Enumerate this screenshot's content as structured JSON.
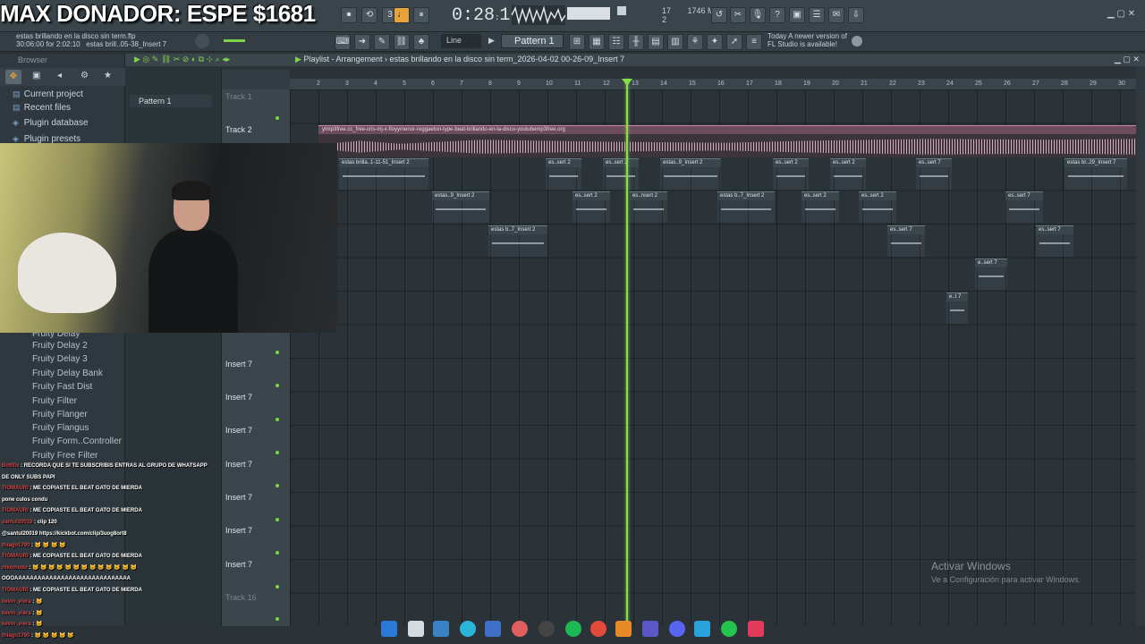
{
  "overlay": {
    "title": "MAX DONADOR: ESPE $1681"
  },
  "toolbar": {
    "time": "0:28",
    "time_sub": "16",
    "mem_top": "17",
    "mem_mb": "1746 MB",
    "mem_bottom": "2",
    "line_mode": "Line",
    "pattern": "Pattern 1"
  },
  "project": {
    "file": "estas brillando en la disco sin term.flp",
    "hint_time": "30:06:00 for 2:02:10",
    "hint_insert": "estas brill..05-38_Insert 7"
  },
  "news": {
    "line1": "Today  A newer version of",
    "line2": "FL Studio is available!"
  },
  "browser": {
    "title": "Browser",
    "items": [
      "Current project",
      "Recent files",
      "Plugin database",
      "Plugin presets"
    ],
    "plugins": [
      "Fruity Delay",
      "Fruity Delay 2",
      "Fruity Delay 3",
      "Fruity Delay Bank",
      "Fruity Fast Dist",
      "Fruity Filter",
      "Fruity Flanger",
      "Fruity Flangus",
      "Fruity Form..Controller",
      "Fruity Free Filter"
    ]
  },
  "patterns": {
    "item": "Pattern 1"
  },
  "playlist": {
    "title": "Playlist - Arrangement  ›  estas brillando en la disco sin term_2026-04-02 00-26-09_Insert 7",
    "ruler": [
      "2",
      "3",
      "4",
      "5",
      "6",
      "7",
      "8",
      "9",
      "10",
      "11",
      "12",
      "13",
      "14",
      "15",
      "16",
      "17",
      "18",
      "19",
      "20",
      "21",
      "22",
      "23",
      "24",
      "25",
      "26",
      "27",
      "28",
      "29",
      "30"
    ],
    "tracks": [
      "Track 1",
      "Track 2",
      "Insert 7",
      "Insert 7",
      "Insert 7",
      "Insert 7",
      "Insert 7",
      "Insert 7",
      "Insert 7",
      "Track 16"
    ],
    "audio_clip": "ytmp3free.cc_free-cris-mj-x-floyymenor-reggaeton-type-beat-brillando-en-la-disco-youtubemp3free.org",
    "clips": [
      "estas brilla..1-11-51_Insert 2",
      "es..sert 2",
      "es..sert 2",
      "estas..9_Insert 2",
      "es..sert 2",
      "es..sert 2",
      "es..sert 7",
      "estas br..29_Insert 7",
      "estas..9_Insert 2",
      "es..sert 2",
      "es..nsert 2",
      "estas b..7_Insert 2",
      "es..sert 2",
      "es..sert 2",
      "es..sert 7",
      "estas b..7_Insert 2",
      "es..sert 7",
      "es..sert 7",
      "e..sert 7",
      "e..t 7"
    ]
  },
  "chat": [
    {
      "user": "BotRix",
      "msg": "RECORDA QUE SI TE SUBSCRIBIS ENTRAS AL GRUPO DE WHATSAPP"
    },
    {
      "user": "",
      "msg": "DE ONLY SUBS PAPI"
    },
    {
      "user": "TIOMAURI",
      "msg": "ME COPIASTE EL BEAT GATO DE MIERDA"
    },
    {
      "user": "",
      "msg": "pone culos condu"
    },
    {
      "user": "TIOMAURI",
      "msg": "ME COPIASTE EL BEAT GATO DE MIERDA"
    },
    {
      "user": "santul20019",
      "msg": "clip 120"
    },
    {
      "user": "",
      "msg": "@santul20019 https://kickbot.com/clip/3uog8ort8"
    },
    {
      "user": "thiago1790",
      "msg": "🐱 🐱 🐱 🐱"
    },
    {
      "user": "TIOMAURI",
      "msg": "ME COPIASTE EL BEAT GATO DE MIERDA"
    },
    {
      "user": "nikomudo",
      "msg": "🐱 🐱 🐱 🐱 🐱 🐱 🐱 🐱 🐱 🐱 🐱 🐱 🐱"
    },
    {
      "user": "",
      "msg": "OOOAAAAAAAAAAAAAAAAAAAAAAAAAAAAAA"
    },
    {
      "user": "TIOMAURI",
      "msg": "ME COPIASTE EL BEAT GATO DE MIERDA"
    },
    {
      "user": "kevin_viera",
      "msg": "🐱"
    },
    {
      "user": "kevin_viera",
      "msg": "🐱"
    },
    {
      "user": "kevin_viera",
      "msg": "🐱"
    },
    {
      "user": "thiago1790",
      "msg": "🐱 🐱 🐱 🐱 🐱"
    }
  ],
  "watermark": {
    "line1": "Activar Windows",
    "line2": "Ve a Configuración para activar Windows."
  },
  "colors": {
    "accent": "#84e046",
    "audio": "#c58aa4",
    "panel": "#2b3339"
  }
}
